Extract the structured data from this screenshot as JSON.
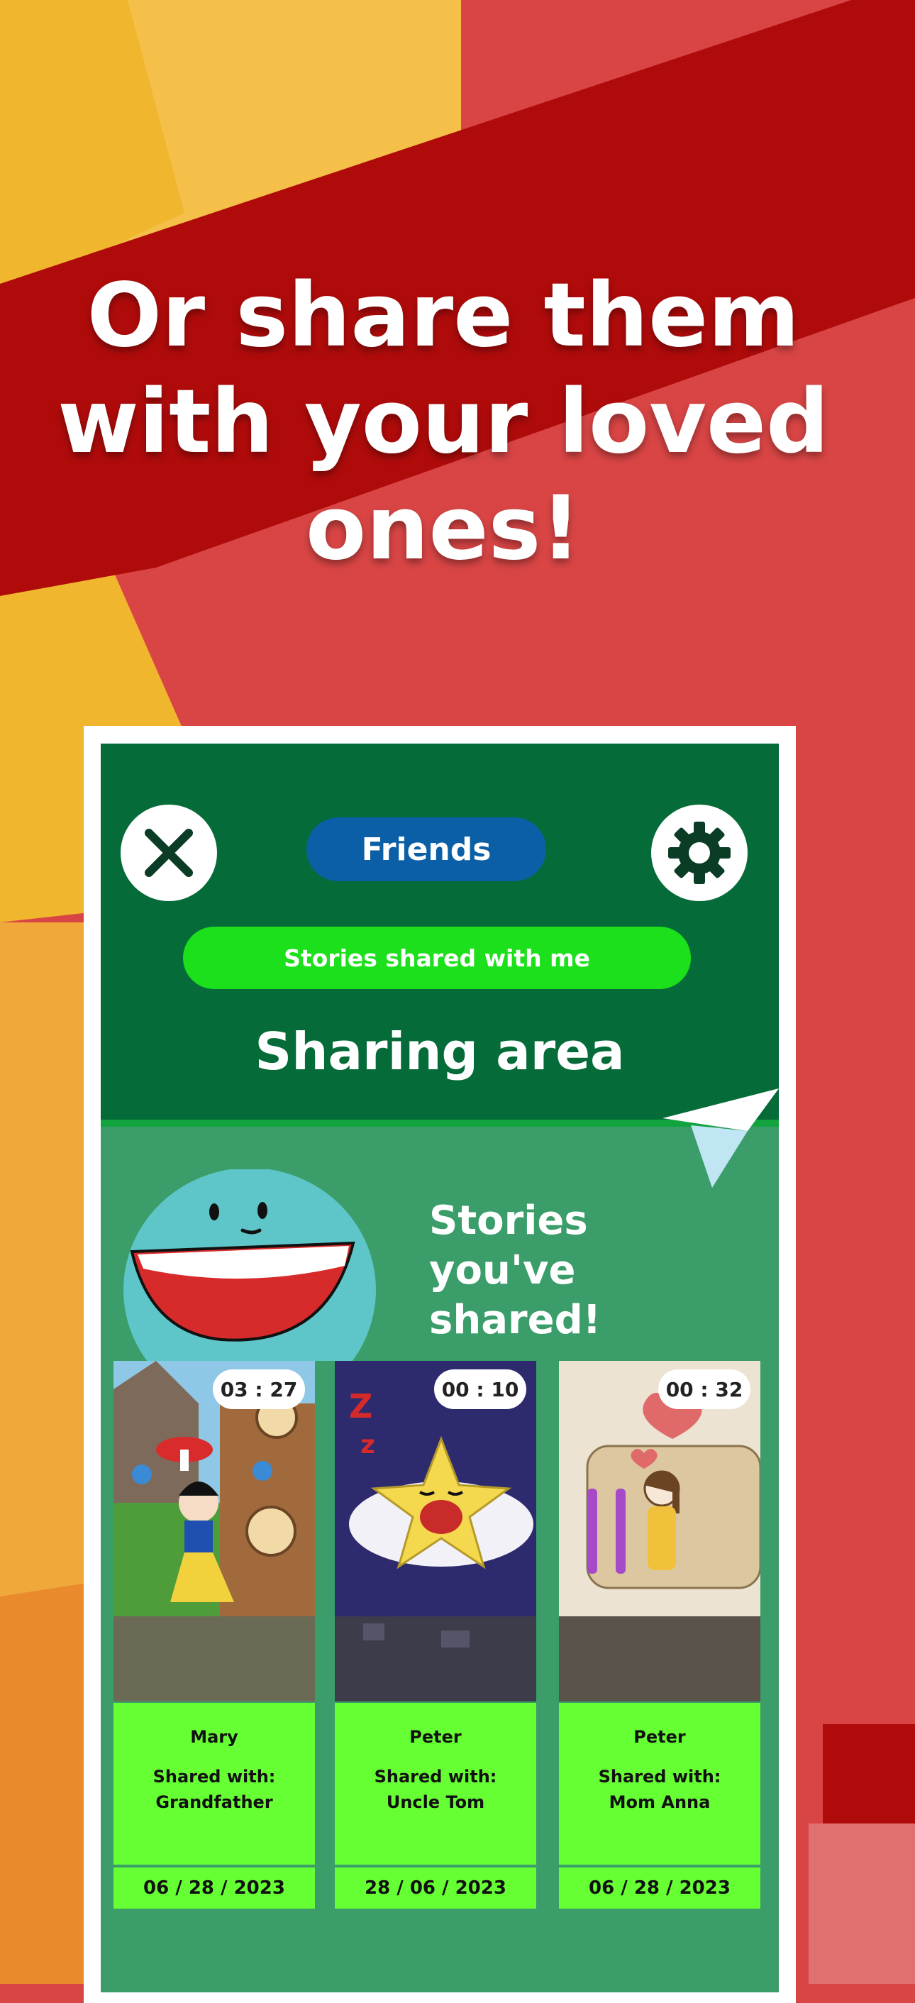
{
  "headline": {
    "line1": "Or share them",
    "line2": "with your loved",
    "line3": "ones!"
  },
  "header": {
    "close_icon": "close-icon",
    "settings_icon": "gear-icon",
    "friends_label": "Friends",
    "shared_with_me_label": "Stories shared with me",
    "title": "Sharing area"
  },
  "section": {
    "line1": "Stories",
    "line2": "you've",
    "line3": "shared!"
  },
  "stories": [
    {
      "duration": "03 : 27",
      "name": "Mary",
      "shared_with_label": "Shared with:",
      "shared_with": "Grandfather",
      "date": "06 / 28 / 2023"
    },
    {
      "duration": "00 : 10",
      "name": "Peter",
      "shared_with_label": "Shared with:",
      "shared_with": "Uncle Tom",
      "date": "28 / 06 / 2023"
    },
    {
      "duration": "00 : 32",
      "name": "Peter",
      "shared_with_label": "Shared with:",
      "shared_with": "Mom Anna",
      "date": "06 / 28 / 2023"
    }
  ],
  "colors": {
    "header_green": "#056b38",
    "panel_green": "#3a9d6a",
    "friends_blue": "#0a5fa6",
    "bright_green": "#1be01b",
    "card_green": "#66ff33"
  }
}
